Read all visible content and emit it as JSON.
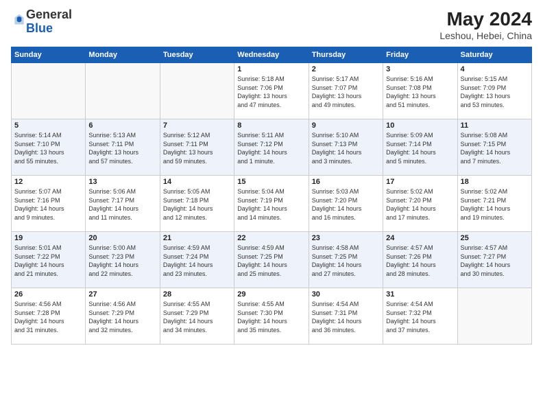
{
  "logo": {
    "general": "General",
    "blue": "Blue"
  },
  "title": "May 2024",
  "subtitle": "Leshou, Hebei, China",
  "weekdays": [
    "Sunday",
    "Monday",
    "Tuesday",
    "Wednesday",
    "Thursday",
    "Friday",
    "Saturday"
  ],
  "weeks": [
    [
      {
        "day": "",
        "info": ""
      },
      {
        "day": "",
        "info": ""
      },
      {
        "day": "",
        "info": ""
      },
      {
        "day": "1",
        "info": "Sunrise: 5:18 AM\nSunset: 7:06 PM\nDaylight: 13 hours\nand 47 minutes."
      },
      {
        "day": "2",
        "info": "Sunrise: 5:17 AM\nSunset: 7:07 PM\nDaylight: 13 hours\nand 49 minutes."
      },
      {
        "day": "3",
        "info": "Sunrise: 5:16 AM\nSunset: 7:08 PM\nDaylight: 13 hours\nand 51 minutes."
      },
      {
        "day": "4",
        "info": "Sunrise: 5:15 AM\nSunset: 7:09 PM\nDaylight: 13 hours\nand 53 minutes."
      }
    ],
    [
      {
        "day": "5",
        "info": "Sunrise: 5:14 AM\nSunset: 7:10 PM\nDaylight: 13 hours\nand 55 minutes."
      },
      {
        "day": "6",
        "info": "Sunrise: 5:13 AM\nSunset: 7:11 PM\nDaylight: 13 hours\nand 57 minutes."
      },
      {
        "day": "7",
        "info": "Sunrise: 5:12 AM\nSunset: 7:11 PM\nDaylight: 13 hours\nand 59 minutes."
      },
      {
        "day": "8",
        "info": "Sunrise: 5:11 AM\nSunset: 7:12 PM\nDaylight: 14 hours\nand 1 minute."
      },
      {
        "day": "9",
        "info": "Sunrise: 5:10 AM\nSunset: 7:13 PM\nDaylight: 14 hours\nand 3 minutes."
      },
      {
        "day": "10",
        "info": "Sunrise: 5:09 AM\nSunset: 7:14 PM\nDaylight: 14 hours\nand 5 minutes."
      },
      {
        "day": "11",
        "info": "Sunrise: 5:08 AM\nSunset: 7:15 PM\nDaylight: 14 hours\nand 7 minutes."
      }
    ],
    [
      {
        "day": "12",
        "info": "Sunrise: 5:07 AM\nSunset: 7:16 PM\nDaylight: 14 hours\nand 9 minutes."
      },
      {
        "day": "13",
        "info": "Sunrise: 5:06 AM\nSunset: 7:17 PM\nDaylight: 14 hours\nand 11 minutes."
      },
      {
        "day": "14",
        "info": "Sunrise: 5:05 AM\nSunset: 7:18 PM\nDaylight: 14 hours\nand 12 minutes."
      },
      {
        "day": "15",
        "info": "Sunrise: 5:04 AM\nSunset: 7:19 PM\nDaylight: 14 hours\nand 14 minutes."
      },
      {
        "day": "16",
        "info": "Sunrise: 5:03 AM\nSunset: 7:20 PM\nDaylight: 14 hours\nand 16 minutes."
      },
      {
        "day": "17",
        "info": "Sunrise: 5:02 AM\nSunset: 7:20 PM\nDaylight: 14 hours\nand 17 minutes."
      },
      {
        "day": "18",
        "info": "Sunrise: 5:02 AM\nSunset: 7:21 PM\nDaylight: 14 hours\nand 19 minutes."
      }
    ],
    [
      {
        "day": "19",
        "info": "Sunrise: 5:01 AM\nSunset: 7:22 PM\nDaylight: 14 hours\nand 21 minutes."
      },
      {
        "day": "20",
        "info": "Sunrise: 5:00 AM\nSunset: 7:23 PM\nDaylight: 14 hours\nand 22 minutes."
      },
      {
        "day": "21",
        "info": "Sunrise: 4:59 AM\nSunset: 7:24 PM\nDaylight: 14 hours\nand 23 minutes."
      },
      {
        "day": "22",
        "info": "Sunrise: 4:59 AM\nSunset: 7:25 PM\nDaylight: 14 hours\nand 25 minutes."
      },
      {
        "day": "23",
        "info": "Sunrise: 4:58 AM\nSunset: 7:25 PM\nDaylight: 14 hours\nand 27 minutes."
      },
      {
        "day": "24",
        "info": "Sunrise: 4:57 AM\nSunset: 7:26 PM\nDaylight: 14 hours\nand 28 minutes."
      },
      {
        "day": "25",
        "info": "Sunrise: 4:57 AM\nSunset: 7:27 PM\nDaylight: 14 hours\nand 30 minutes."
      }
    ],
    [
      {
        "day": "26",
        "info": "Sunrise: 4:56 AM\nSunset: 7:28 PM\nDaylight: 14 hours\nand 31 minutes."
      },
      {
        "day": "27",
        "info": "Sunrise: 4:56 AM\nSunset: 7:29 PM\nDaylight: 14 hours\nand 32 minutes."
      },
      {
        "day": "28",
        "info": "Sunrise: 4:55 AM\nSunset: 7:29 PM\nDaylight: 14 hours\nand 34 minutes."
      },
      {
        "day": "29",
        "info": "Sunrise: 4:55 AM\nSunset: 7:30 PM\nDaylight: 14 hours\nand 35 minutes."
      },
      {
        "day": "30",
        "info": "Sunrise: 4:54 AM\nSunset: 7:31 PM\nDaylight: 14 hours\nand 36 minutes."
      },
      {
        "day": "31",
        "info": "Sunrise: 4:54 AM\nSunset: 7:32 PM\nDaylight: 14 hours\nand 37 minutes."
      },
      {
        "day": "",
        "info": ""
      }
    ]
  ]
}
